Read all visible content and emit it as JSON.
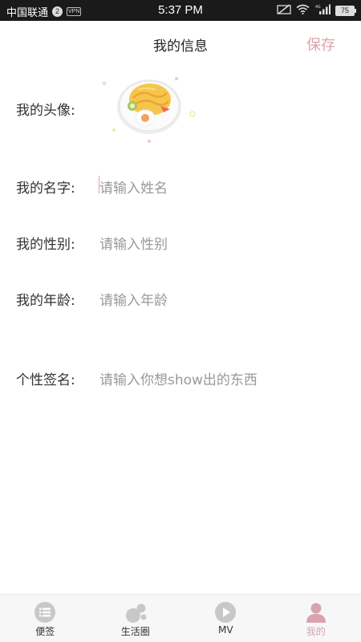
{
  "status_bar": {
    "carrier": "中国联通",
    "badge": "2",
    "vpn": "VPN",
    "time": "5:37 PM",
    "network": "4G",
    "battery": "75"
  },
  "header": {
    "title": "我的信息",
    "save_label": "保存"
  },
  "form": {
    "avatar_label": "我的头像:",
    "name_label": "我的名字:",
    "name_placeholder": "请输入姓名",
    "gender_label": "我的性别:",
    "gender_placeholder": "请输入性别",
    "age_label": "我的年龄:",
    "age_placeholder": "请输入年龄",
    "signature_label": "个性签名:",
    "signature_placeholder": "请输入你想show出的东西"
  },
  "tabs": [
    {
      "label": "便签",
      "icon": "list-icon",
      "active": false
    },
    {
      "label": "生活圈",
      "icon": "bubbles-icon",
      "active": false
    },
    {
      "label": "MV",
      "icon": "play-icon",
      "active": false
    },
    {
      "label": "我的",
      "icon": "person-icon",
      "active": true
    }
  ],
  "colors": {
    "accent": "#d9a3ad",
    "tab_icon": "#c8c8c8",
    "status_bar": "#1a1a1a"
  }
}
